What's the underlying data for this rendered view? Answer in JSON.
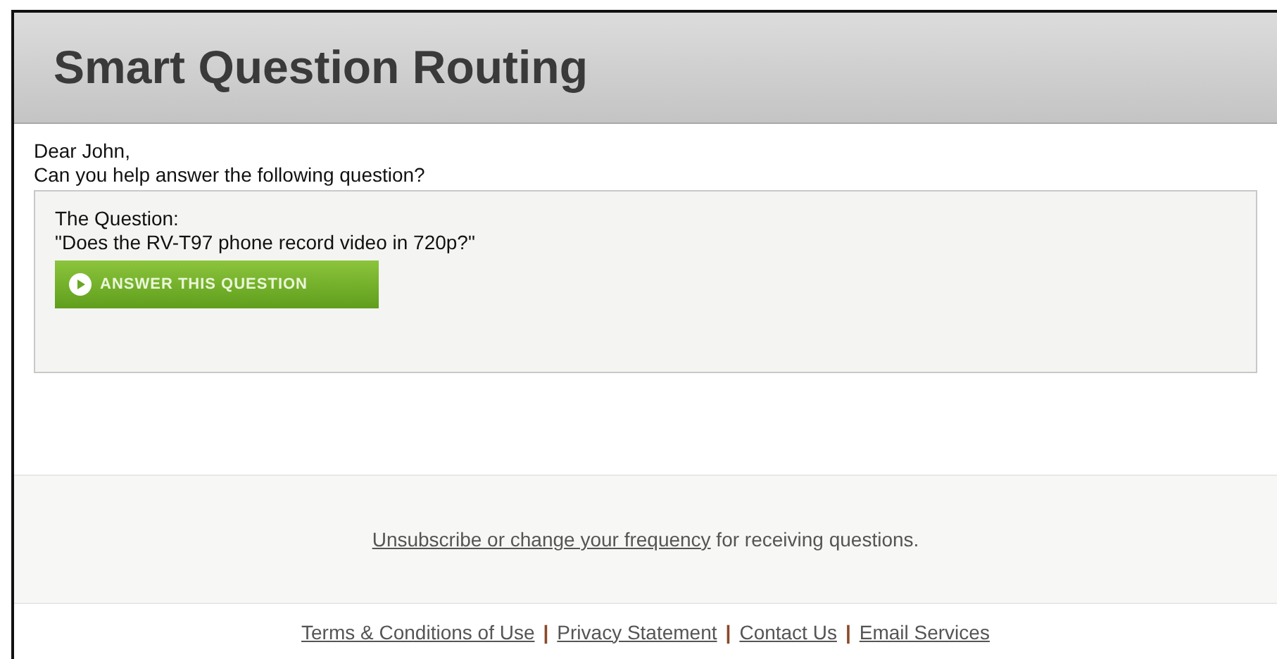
{
  "header": {
    "title": "Smart Question Routing"
  },
  "greeting": "Dear John,",
  "prompt": "Can you help answer the following question?",
  "question": {
    "label": "The Question:",
    "text": "\"Does the RV-T97 phone record video in 720p?\"",
    "button": "ANSWER THIS QUESTION"
  },
  "unsubscribe": {
    "link": "Unsubscribe or change your frequency",
    "rest": " for receiving questions."
  },
  "footer_links": [
    {
      "label": "Terms & Conditions of Use",
      "separator": "|"
    },
    {
      "label": "Privacy Statement",
      "separator": "|"
    },
    {
      "label": "Contact Us",
      "separator": "|"
    },
    {
      "label": "Email Services"
    }
  ]
}
